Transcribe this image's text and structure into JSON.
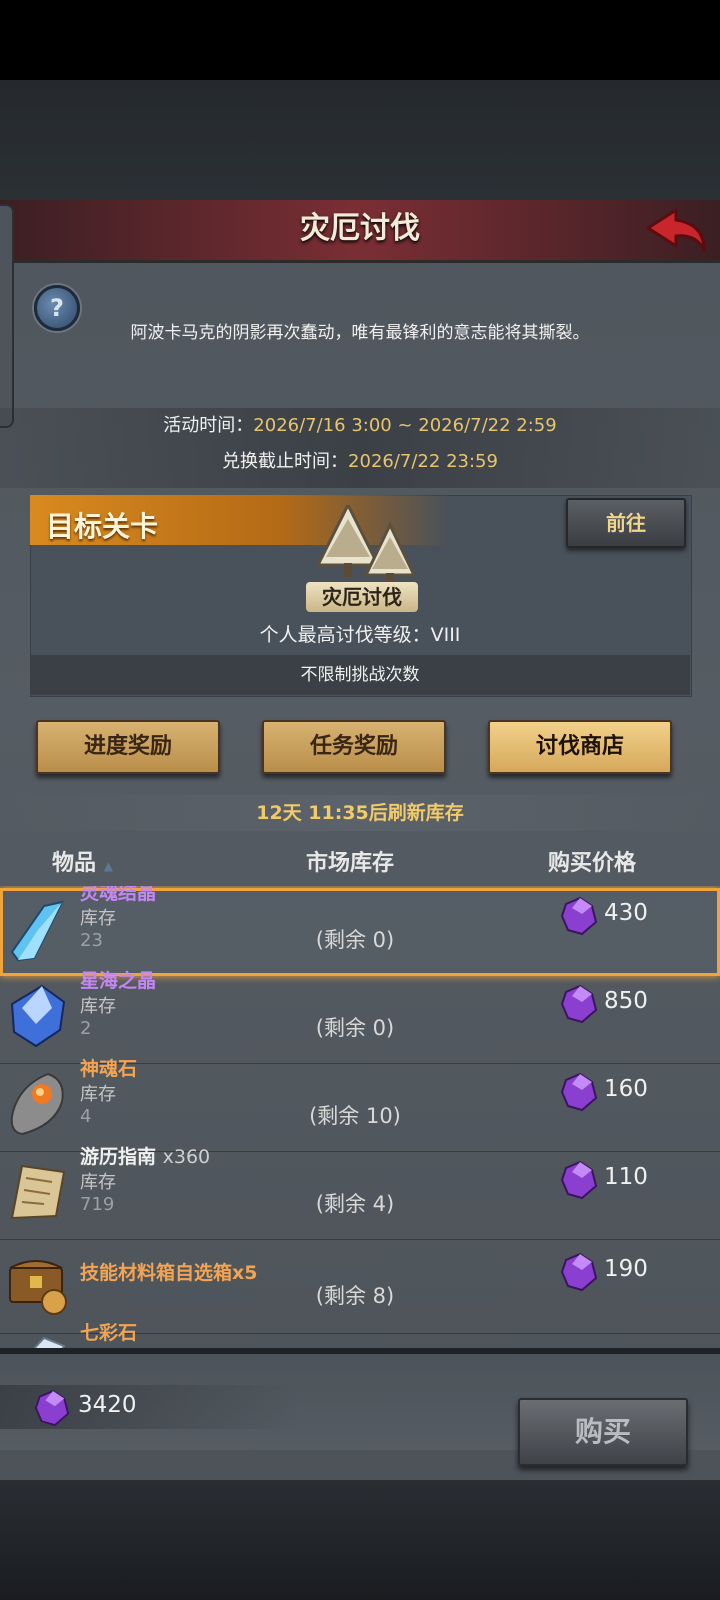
{
  "header": {
    "title": "灾厄讨伐"
  },
  "description": "阿波卡马克的阴影再次蠢动，唯有最锋利的意志能将其撕裂。",
  "schedule": {
    "activity_label": "活动时间：",
    "activity_value": "2026/7/16 3:00 ~ 2026/7/22 2:59",
    "exchange_label": "兑换截止时间：",
    "exchange_value": "2026/7/22 23:59"
  },
  "target": {
    "banner": "目标关卡",
    "goto_label": "前往",
    "stage_name": "灾厄讨伐",
    "level_text": "个人最高讨伐等级：VIII",
    "limit_text": "不限制挑战次数"
  },
  "tabs": [
    {
      "label": "进度奖励",
      "active": false
    },
    {
      "label": "任务奖励",
      "active": false
    },
    {
      "label": "讨伐商店",
      "active": true
    }
  ],
  "refresh_text": "12天 11:35后刷新库存",
  "columns": {
    "item": "物品",
    "stock": "市场库存",
    "price": "购买价格"
  },
  "items": [
    {
      "name": "灵魂结晶",
      "qty": "",
      "stock_label": "库存",
      "stock": "23",
      "remaining": "(剩余 0)",
      "price": "430",
      "rarity": "purple",
      "icon": "blue-crystal-icon",
      "selected": true
    },
    {
      "name": "星海之晶",
      "qty": "",
      "stock_label": "库存",
      "stock": "2",
      "remaining": "(剩余 0)",
      "price": "850",
      "rarity": "purple",
      "icon": "star-crystal-icon",
      "selected": false
    },
    {
      "name": "神魂石",
      "qty": "",
      "stock_label": "库存",
      "stock": "4",
      "remaining": "(剩余 10)",
      "price": "160",
      "rarity": "orange",
      "icon": "soul-stone-icon",
      "selected": false
    },
    {
      "name": "游历指南",
      "qty": "x360",
      "stock_label": "库存",
      "stock": "719",
      "remaining": "(剩余 4)",
      "price": "110",
      "rarity": "white",
      "icon": "scroll-map-icon",
      "selected": false
    },
    {
      "name": "技能材料箱自选箱x5",
      "qty": "",
      "stock_label": "",
      "stock": "",
      "remaining": "(剩余 8)",
      "price": "190",
      "rarity": "orange",
      "icon": "treasure-chest-icon",
      "selected": false
    },
    {
      "name": "七彩石",
      "qty": "",
      "stock_label": "",
      "stock": "",
      "remaining": "",
      "price": "",
      "rarity": "orange",
      "icon": "rainbow-stone-icon",
      "selected": false
    }
  ],
  "footer": {
    "balance": "3420",
    "buy_label": "购买"
  },
  "colors": {
    "accent_gold": "#f1ca6a",
    "rarity_purple": "#c486f2",
    "rarity_orange": "#f2a453",
    "selection": "#f0a43a",
    "currency": "#8a3fd0"
  }
}
